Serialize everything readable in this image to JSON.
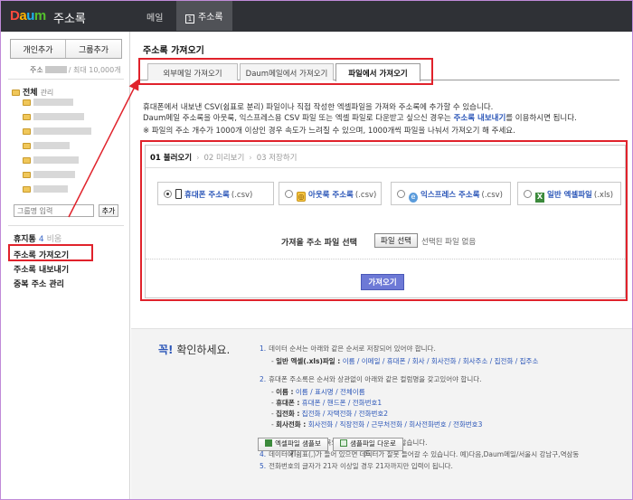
{
  "app": {
    "logo": "Daum",
    "title": "주소록"
  },
  "topnav": {
    "mail": "메일",
    "address": "주소록"
  },
  "sidebar": {
    "add_person": "개인추가",
    "add_group": "그룹추가",
    "count_label": "주소",
    "count_max": "/ 최대 10,000개",
    "root": "전체",
    "manage": "관리",
    "group_placeholder": "그룹명 입력",
    "group_add": "추가",
    "trash": "휴지통",
    "trash_count": "4",
    "trash_empty": "비움",
    "menu": [
      "주소록 가져오기",
      "주소록 내보내기",
      "중복 주소 관리"
    ]
  },
  "main": {
    "title": "주소록 가져오기",
    "tabs": [
      {
        "label": "외부메일 가져오기",
        "active": false
      },
      {
        "label": "Daum메일에서 가져오기",
        "active": false
      },
      {
        "label": "파일에서 가져오기",
        "active": true
      }
    ],
    "desc1": "휴대폰에서 내보낸 CSV(쉼표로 분리) 파일이나 직접 작성한 엑셀파일을 가져와 주소록에 추가할 수 있습니다.",
    "desc2_pre": "Daum메일 주소록을 아웃룩, 익스프레스용 CSV 파일 또는 엑셀 파일로 다운받고 싶으신 경우는",
    "desc2_link": "주소록 내보내기",
    "desc2_post": "를 이용하시면 됩니다.",
    "desc3": "※ 파일의 주소 개수가 1000개 이상인 경우 속도가 느려질 수 있으며, 1000개씩 파일을 나눠서 가져오기 해 주세요.",
    "steps": [
      "01 불러오기",
      "02 미리보기",
      "03 저장하기"
    ],
    "options": [
      {
        "name": "휴대폰 주소록",
        "ext": "(.csv)",
        "selected": true
      },
      {
        "name": "아웃룩 주소록",
        "ext": "(.csv)",
        "selected": false
      },
      {
        "name": "익스프레스 주소록",
        "ext": "(.csv)",
        "selected": false
      },
      {
        "name": "일반 엑셀파일",
        "ext": "(.xls)",
        "selected": false
      }
    ],
    "file_label": "가져올 주소 파일 선택",
    "file_button": "파일 선택",
    "file_none": "선택된 파일 없음",
    "import_button": "가져오기"
  },
  "notice": {
    "title_em": "꼭!",
    "title_rest": " 확인하세요.",
    "l1": "데이터 순서는 아래와 같은 순서로 저장되어 있어야 합니다.",
    "l1a_label": "일반 엑셀(.xls)파일 :",
    "l1a_items": "이름 / 이메일 / 휴대폰 / 회사 / 회사전화 / 회사주소 / 집전화 / 집주소",
    "l2": "휴대폰 주소록은 순서와 상관없이 아래와 같은 컬럼명을 갖고있어야 합니다.",
    "cols": [
      {
        "label": "이름 :",
        "items": "이름 / 표시명 / 전체이름"
      },
      {
        "label": "휴대폰 :",
        "items": "휴대폰 / 핸드폰 / 전화번호1"
      },
      {
        "label": "집전화 :",
        "items": "집전화 / 자택전화 / 전화번호2"
      },
      {
        "label": "회사전화 :",
        "items": "회사전화 / 직장전화 / 근무처전화 / 회사전화번호 / 전화번호3"
      }
    ],
    "l3": "첫 행의 데이터는 제목으로 간주하여 가져오지 않습니다.",
    "l4": "데이터에 쉼표(,)가 들어 있으면 데이터가 잘못 들어갈 수 있습니다. 예)다음,Daum메일/서울시 강남구,역삼동",
    "l5": "전화번호의 글자가 21자 이상일 경우 21자까지만 입력이 됩니다.",
    "btn_sample_view": "엑셀파일 샘플보기",
    "btn_sample_download": "샘플파일 다운로드"
  },
  "colors": {
    "accent": "#e0222b",
    "link": "#2b56b8",
    "topbar": "#2f3136",
    "button": "#6d79d6"
  }
}
